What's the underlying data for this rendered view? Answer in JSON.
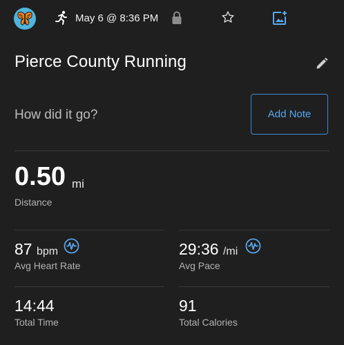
{
  "header": {
    "date": "May 6 @ 8:36 PM",
    "icons": [
      "butterfly-avatar",
      "running-icon",
      "lock-icon",
      "star-icon",
      "add-photo-icon"
    ]
  },
  "activity": {
    "title": "Pierce County Running",
    "prompt": "How did it go?",
    "add_note_label": "Add Note"
  },
  "distance": {
    "value": "0.50",
    "unit": "mi",
    "label": "Distance"
  },
  "stats": {
    "heart_rate": {
      "value": "87",
      "unit": "bpm",
      "label": "Avg Heart Rate"
    },
    "pace": {
      "value": "29:36",
      "unit": "/mi",
      "label": "Avg Pace"
    },
    "time": {
      "value": "14:44",
      "label": "Total Time"
    },
    "calories": {
      "value": "91",
      "label": "Total Calories"
    }
  },
  "colors": {
    "background": "#1f1f1f",
    "accent": "#3c8fd6",
    "icon_blue": "#5aa9f0"
  }
}
